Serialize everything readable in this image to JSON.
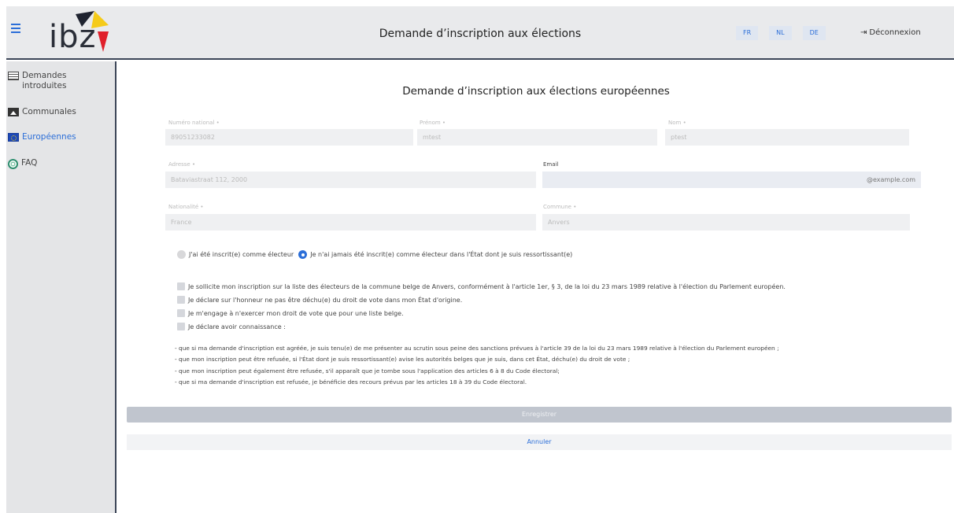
{
  "header": {
    "title": "Demande d’inscription aux élections",
    "logo_text": "ibz",
    "languages": [
      "FR",
      "NL",
      "DE"
    ],
    "logout_label": "Déconnexion"
  },
  "sidebar": {
    "items": [
      {
        "line1": "Demandes",
        "line2": "introduites",
        "icon": "documents-icon"
      },
      {
        "label": "Communales",
        "icon": "image-icon"
      },
      {
        "label": "Européennes",
        "icon": "eu-flag-icon"
      },
      {
        "label": "FAQ",
        "icon": "faq-icon"
      }
    ]
  },
  "form": {
    "title": "Demande d’inscription aux élections européennes",
    "national_number": {
      "label": "Numéro national •",
      "value": "89051233082"
    },
    "first_name": {
      "label": "Prénom •",
      "value": "mtest"
    },
    "last_name": {
      "label": "Nom •",
      "value": "ptest"
    },
    "address": {
      "label": "Adresse •",
      "value": "Bataviastraat 112, 2000"
    },
    "email": {
      "label": "Email",
      "value": "@example.com"
    },
    "nationality": {
      "label": "Nationalité •",
      "value": "France"
    },
    "municipality": {
      "label": "Commune •",
      "value": "Anvers"
    },
    "radio_options": [
      {
        "label": "J'ai été inscrit(e) comme électeur",
        "selected": false
      },
      {
        "label": "Je n'ai jamais été inscrit(e) comme électeur dans l'État dont je suis ressortissant(e)",
        "selected": true
      }
    ],
    "checkboxes": [
      "Je sollicite mon inscription sur la liste des électeurs de la commune belge de Anvers, conformément à l'article 1er, § 3, de la loi du 23 mars 1989 relative à l'élection du Parlement européen.",
      "Je déclare sur l'honneur ne pas être déchu(e) du droit de vote dans mon État d'origine.",
      "Je m'engage à n'exercer mon droit de vote que pour une liste belge.",
      "Je déclare avoir connaissance :"
    ],
    "bullets": [
      "-  que si ma demande d'inscription est agréée, je suis tenu(e) de me présenter au scrutin sous peine des sanctions prévues à l'article 39 de la loi du 23 mars 1989 relative à l'élection du Parlement européen ;",
      "-  que mon inscription peut être refusée, si l'État dont je suis ressortissant(e) avise les autorités belges que je suis, dans cet État, déchu(e) du droit de vote ;",
      "-  que mon inscription peut également être refusée, s'il apparaît que je tombe sous l'application des articles 6 à 8 du Code électoral;",
      "-  que si ma demande d'inscription est refusée, je bénéficie des recours prévus par les articles 18 à 39 du Code électoral."
    ],
    "save_label": "Enregistrer",
    "cancel_label": "Annuler"
  },
  "colors": {
    "accent": "#2b6ed8",
    "header_bg": "#e9eaec",
    "sidebar_bg": "#e4e5e7",
    "divider": "#3c4658",
    "save_disabled_bg": "#c0c5ce"
  }
}
